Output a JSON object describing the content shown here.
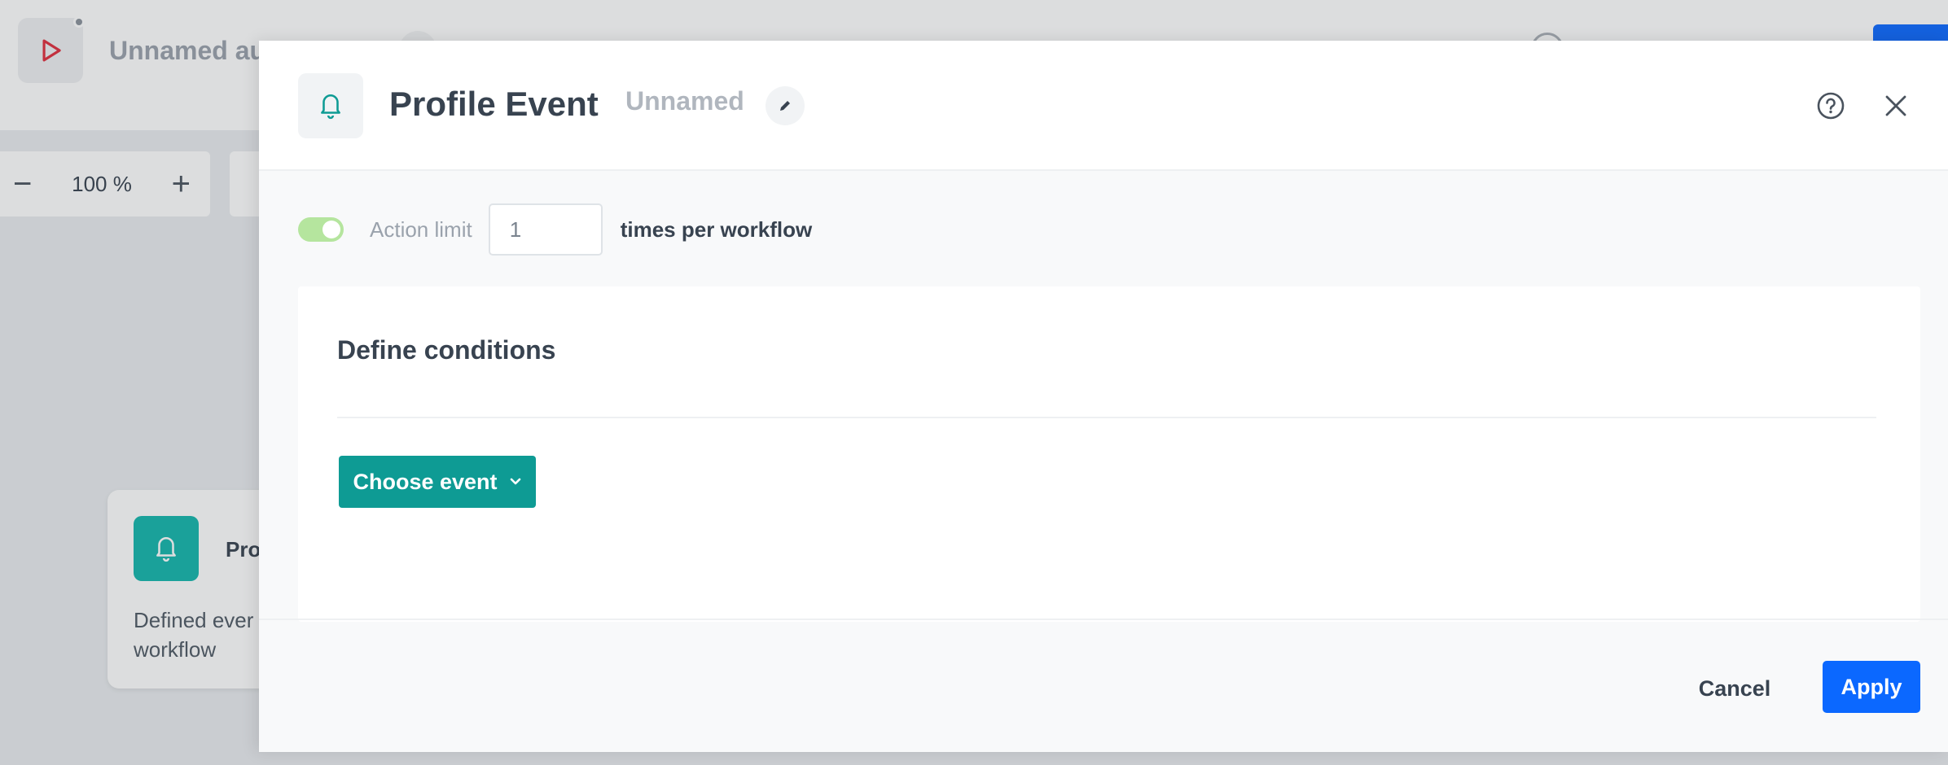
{
  "background": {
    "app_title": "Unnamed au",
    "zoom": {
      "minus": "−",
      "value": "100 %",
      "plus": "+"
    },
    "node_card": {
      "title": "Pro",
      "description": "Defined ever workflow"
    },
    "colors": {
      "play_icon": "#e02d3c",
      "node_icon_bg": "#13b6ac"
    }
  },
  "modal": {
    "title": "Profile Event",
    "subtitle": "Unnamed",
    "icons": {
      "header": "bell-icon",
      "edit": "pencil-icon",
      "help": "help-circle-icon",
      "close": "close-icon"
    },
    "action_limit": {
      "label": "Action limit",
      "value": "1",
      "suffix": "times per workflow",
      "toggle_on": true
    },
    "conditions": {
      "title": "Define conditions",
      "choose_event_label": "Choose event"
    },
    "footer": {
      "cancel_label": "Cancel",
      "apply_label": "Apply"
    },
    "colors": {
      "accent_teal": "#0e9b94",
      "primary_blue": "#0b68ff",
      "toggle_green": "#b5e59e"
    }
  }
}
